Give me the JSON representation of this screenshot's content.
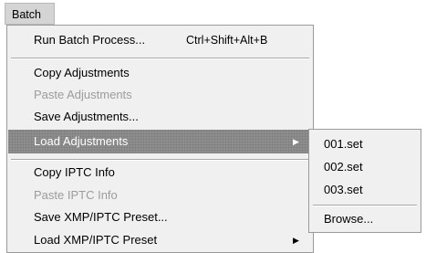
{
  "menubar": {
    "batch": "Batch"
  },
  "menu": {
    "run_batch": "Run Batch Process...",
    "run_batch_shortcut": "Ctrl+Shift+Alt+B",
    "copy_adjustments": "Copy Adjustments",
    "paste_adjustments": "Paste Adjustments",
    "save_adjustments": "Save Adjustments...",
    "load_adjustments": "Load Adjustments",
    "copy_iptc": "Copy IPTC Info",
    "paste_iptc": "Paste IPTC Info",
    "save_xmp": "Save XMP/IPTC Preset...",
    "load_xmp": "Load XMP/IPTC Preset"
  },
  "submenu": {
    "items": [
      "001.set",
      "002.set",
      "003.set"
    ],
    "browse": "Browse..."
  },
  "icons": {
    "submenu_arrow": "right-triangle-icon"
  }
}
